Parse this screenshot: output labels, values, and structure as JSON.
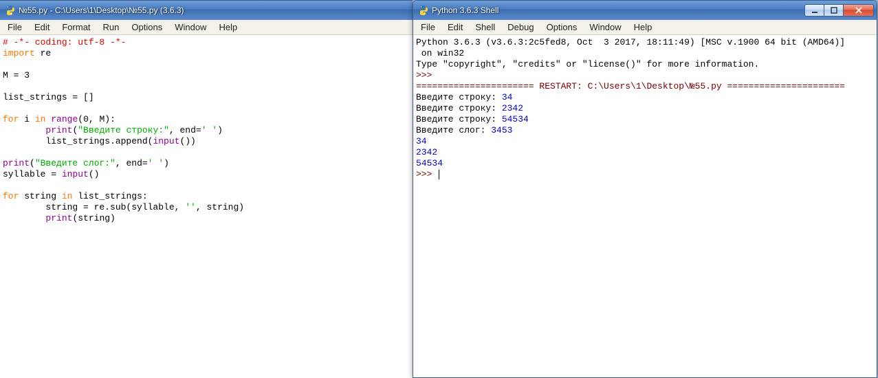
{
  "editor": {
    "title": "№55.py - C:\\Users\\1\\Desktop\\№55.py (3.6.3)",
    "menus": [
      "File",
      "Edit",
      "Format",
      "Run",
      "Options",
      "Window",
      "Help"
    ],
    "code_lines": [
      [
        {
          "t": "# -*- coding: utf-8 -*-",
          "c": "c-comment"
        }
      ],
      [
        {
          "t": "import",
          "c": "c-kw"
        },
        {
          "t": " re",
          "c": "c-plain"
        }
      ],
      [],
      [
        {
          "t": "M = ",
          "c": "c-plain"
        },
        {
          "t": "3",
          "c": "c-plain"
        }
      ],
      [],
      [
        {
          "t": "list_strings = []",
          "c": "c-plain"
        }
      ],
      [],
      [
        {
          "t": "for",
          "c": "c-kw"
        },
        {
          "t": " i ",
          "c": "c-plain"
        },
        {
          "t": "in",
          "c": "c-kw"
        },
        {
          "t": " ",
          "c": "c-plain"
        },
        {
          "t": "range",
          "c": "c-builtin"
        },
        {
          "t": "(",
          "c": "c-plain"
        },
        {
          "t": "0",
          "c": "c-plain"
        },
        {
          "t": ", M):",
          "c": "c-plain"
        }
      ],
      [
        {
          "t": "        ",
          "c": "c-plain"
        },
        {
          "t": "print",
          "c": "c-builtin"
        },
        {
          "t": "(",
          "c": "c-plain"
        },
        {
          "t": "\"Введите строку:\"",
          "c": "c-str"
        },
        {
          "t": ", end=",
          "c": "c-plain"
        },
        {
          "t": "' '",
          "c": "c-str"
        },
        {
          "t": ")",
          "c": "c-plain"
        }
      ],
      [
        {
          "t": "        list_strings.append(",
          "c": "c-plain"
        },
        {
          "t": "input",
          "c": "c-builtin"
        },
        {
          "t": "())",
          "c": "c-plain"
        }
      ],
      [],
      [
        {
          "t": "print",
          "c": "c-builtin"
        },
        {
          "t": "(",
          "c": "c-plain"
        },
        {
          "t": "\"Введите слог:\"",
          "c": "c-str"
        },
        {
          "t": ", end=",
          "c": "c-plain"
        },
        {
          "t": "' '",
          "c": "c-str"
        },
        {
          "t": ")",
          "c": "c-plain"
        }
      ],
      [
        {
          "t": "syllable = ",
          "c": "c-plain"
        },
        {
          "t": "input",
          "c": "c-builtin"
        },
        {
          "t": "()",
          "c": "c-plain"
        }
      ],
      [],
      [
        {
          "t": "for",
          "c": "c-kw"
        },
        {
          "t": " string ",
          "c": "c-plain"
        },
        {
          "t": "in",
          "c": "c-kw"
        },
        {
          "t": " list_strings:",
          "c": "c-plain"
        }
      ],
      [
        {
          "t": "        string = re.sub(syllable, ",
          "c": "c-plain"
        },
        {
          "t": "''",
          "c": "c-str"
        },
        {
          "t": ", string)",
          "c": "c-plain"
        }
      ],
      [
        {
          "t": "        ",
          "c": "c-plain"
        },
        {
          "t": "print",
          "c": "c-builtin"
        },
        {
          "t": "(string)",
          "c": "c-plain"
        }
      ]
    ]
  },
  "shell": {
    "title": "Python 3.6.3 Shell",
    "menus": [
      "File",
      "Edit",
      "Shell",
      "Debug",
      "Options",
      "Window",
      "Help"
    ],
    "lines": [
      [
        {
          "t": "Python 3.6.3 (v3.6.3:2c5fed8, Oct  3 2017, 18:11:49) [MSC v.1900 64 bit (AMD64)]",
          "c": "c-plain"
        }
      ],
      [
        {
          "t": " on win32",
          "c": "c-plain"
        }
      ],
      [
        {
          "t": "Type \"copyright\", \"credits\" or \"license()\" for more information.",
          "c": "c-plain"
        }
      ],
      [
        {
          "t": ">>> ",
          "c": "c-prompt"
        }
      ],
      [
        {
          "t": "====================== RESTART: C:\\Users\\1\\Desktop\\№55.py ======================",
          "c": "c-prompt"
        }
      ],
      [
        {
          "t": "Введите строку: ",
          "c": "c-plain"
        },
        {
          "t": "34",
          "c": "c-out"
        }
      ],
      [
        {
          "t": "Введите строку: ",
          "c": "c-plain"
        },
        {
          "t": "2342",
          "c": "c-out"
        }
      ],
      [
        {
          "t": "Введите строку: ",
          "c": "c-plain"
        },
        {
          "t": "54534",
          "c": "c-out"
        }
      ],
      [
        {
          "t": "Введите слог: ",
          "c": "c-plain"
        },
        {
          "t": "3453",
          "c": "c-out"
        }
      ],
      [
        {
          "t": "34",
          "c": "c-out"
        }
      ],
      [
        {
          "t": "2342",
          "c": "c-out"
        }
      ],
      [
        {
          "t": "54534",
          "c": "c-out"
        }
      ],
      [
        {
          "t": ">>> ",
          "c": "c-prompt"
        },
        {
          "t": "CURSOR",
          "c": "cursor"
        }
      ]
    ]
  }
}
